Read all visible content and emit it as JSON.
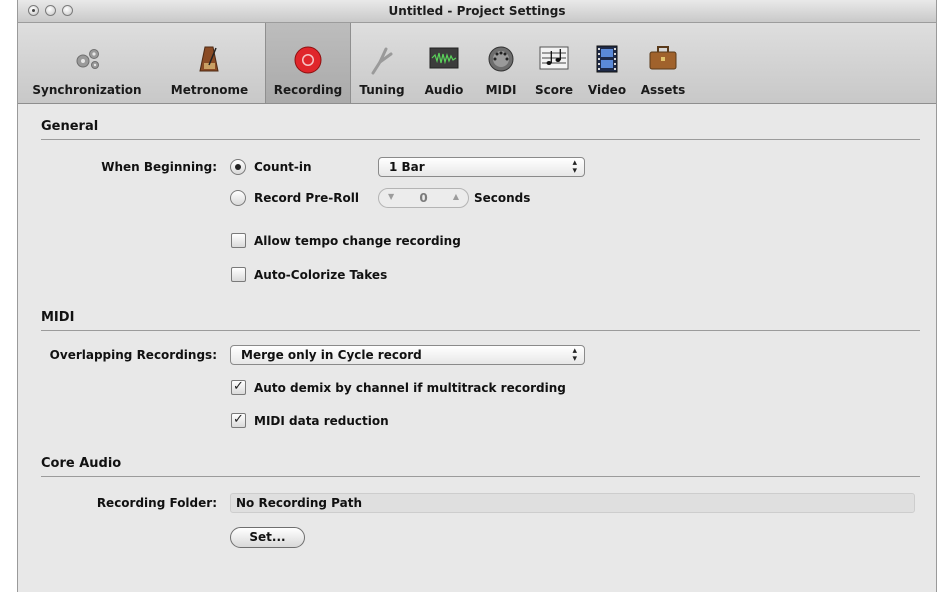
{
  "window": {
    "title": "Untitled - Project Settings"
  },
  "toolbar": {
    "items": [
      {
        "label": "Synchronization",
        "icon": "gears-icon",
        "selected": false
      },
      {
        "label": "Metronome",
        "icon": "metronome-icon",
        "selected": false
      },
      {
        "label": "Recording",
        "icon": "record-icon",
        "selected": true
      },
      {
        "label": "Tuning",
        "icon": "tuning-fork-icon",
        "selected": false
      },
      {
        "label": "Audio",
        "icon": "audio-waveform-icon",
        "selected": false
      },
      {
        "label": "MIDI",
        "icon": "midi-connector-icon",
        "selected": false
      },
      {
        "label": "Score",
        "icon": "score-notes-icon",
        "selected": false
      },
      {
        "label": "Video",
        "icon": "film-icon",
        "selected": false
      },
      {
        "label": "Assets",
        "icon": "briefcase-icon",
        "selected": false
      }
    ]
  },
  "general": {
    "heading": "General",
    "when_beginning_label": "When Beginning:",
    "count_in_label": "Count-in",
    "count_in_selected": true,
    "count_in_value": "1 Bar",
    "pre_roll_label": "Record Pre-Roll",
    "pre_roll_value": "0",
    "pre_roll_unit": "Seconds",
    "allow_tempo_label": "Allow tempo change recording",
    "allow_tempo_checked": false,
    "auto_colorize_label": "Auto-Colorize Takes",
    "auto_colorize_checked": false
  },
  "midi": {
    "heading": "MIDI",
    "overlapping_label": "Overlapping Recordings:",
    "overlapping_value": "Merge only in Cycle record",
    "auto_demix_label": "Auto demix by channel if multitrack recording",
    "auto_demix_checked": true,
    "data_reduction_label": "MIDI data reduction",
    "data_reduction_checked": true
  },
  "core_audio": {
    "heading": "Core Audio",
    "folder_label": "Recording Folder:",
    "folder_value": "No Recording Path",
    "set_button": "Set..."
  },
  "colors": {
    "record_red": "#e0262b",
    "window_bg": "#e8e8e8"
  }
}
